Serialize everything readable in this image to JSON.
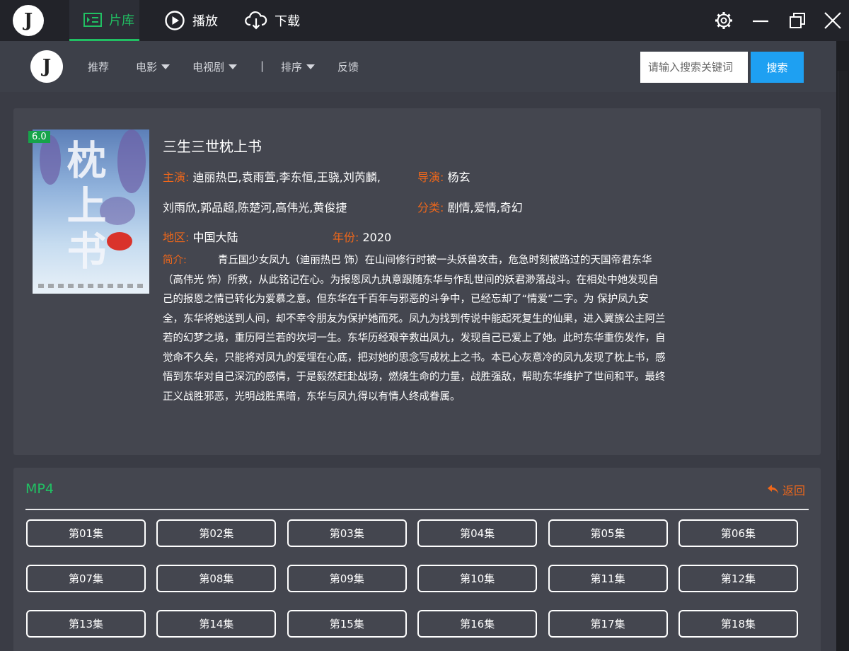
{
  "titlebar": {
    "logo": "J",
    "tabs": [
      {
        "label": "片库",
        "icon": "library-icon",
        "active": true
      },
      {
        "label": "播放",
        "icon": "play-circle-icon",
        "active": false
      },
      {
        "label": "下载",
        "icon": "cloud-download-icon",
        "active": false
      }
    ],
    "accent": "#21c063"
  },
  "nav": {
    "logo": "J",
    "items": [
      {
        "label": "推荐",
        "dropdown": false
      },
      {
        "label": "电影",
        "dropdown": true
      },
      {
        "label": "电视剧",
        "dropdown": true
      },
      {
        "label": "排序",
        "dropdown": true
      },
      {
        "label": "反馈",
        "dropdown": false
      }
    ],
    "separator": "|",
    "search_placeholder": "请输入搜索关键词",
    "search_button": "搜索",
    "search_button_color": "#1ea0f2"
  },
  "detail": {
    "rating": "6.0",
    "poster_title": "枕上书",
    "title": "三生三世枕上书",
    "cast_label": "主演:",
    "cast_line1": "迪丽热巴,袁雨萱,李东恒,王骁,刘芮麟,",
    "cast_line2": "刘雨欣,郭品超,陈楚河,高伟光,黄俊捷",
    "director_label": "导演:",
    "director": "杨玄",
    "genre_label": "分类:",
    "genre": "剧情,爱情,奇幻",
    "region_label": "地区:",
    "region": "中国大陆",
    "year_label": "年份:",
    "year": "2020",
    "synopsis_label": "简介:",
    "synopsis": "青丘国少女凤九（迪丽热巴 饰）在山间修行时被一头妖兽攻击，危急时刻被路过的天国帝君东华（高伟光 饰）所救，从此铭记在心。为报恩凤九执意跟随东华与作乱世间的妖君渺落战斗。在相处中她发现自己的报恩之情已转化为爱慕之意。但东华在千百年与邪恶的斗争中，已经忘却了“情爱”二字。为 保护凤九安全，东华将她送到人间，却不幸令朋友为保护她而死。凤九为找到传说中能起死复生的仙果，进入翼族公主阿兰若的幻梦之境，重历阿兰若的坎坷一生。东华历经艰辛救出凤九，发现自己已爱上了她。此时东华重伤发作，自觉命不久矣，只能将对凤九的爱埋在心底，把对她的思念写成枕上之书。本已心灰意冷的凤九发现了枕上书，感悟到东华对自己深沉的感情，于是毅然赶赴战场，燃烧生命的力量，战胜强敌，帮助东华维护了世间和平。最终正义战胜邪恶，光明战胜黑暗，东华与凤九得以有情人终成眷属。",
    "label_color": "#f0671a"
  },
  "episodes": {
    "format": "MP4",
    "back_label": "返回",
    "items": [
      "第01集",
      "第02集",
      "第03集",
      "第04集",
      "第05集",
      "第06集",
      "第07集",
      "第08集",
      "第09集",
      "第10集",
      "第11集",
      "第12集",
      "第13集",
      "第14集",
      "第15集",
      "第16集",
      "第17集",
      "第18集"
    ]
  }
}
